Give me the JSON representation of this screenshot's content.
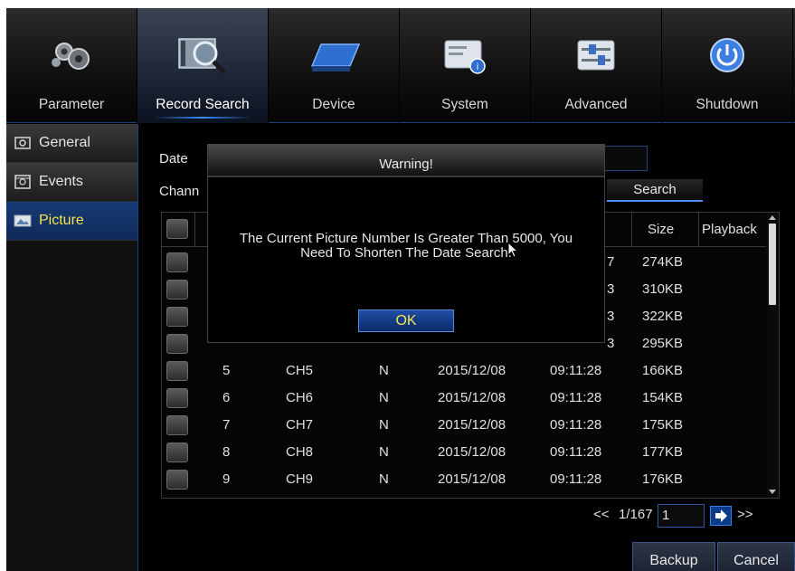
{
  "nav": {
    "items": [
      {
        "label": "Parameter",
        "icon": "gears-icon"
      },
      {
        "label": "Record Search",
        "icon": "film-search-icon"
      },
      {
        "label": "Device",
        "icon": "hard-drive-icon"
      },
      {
        "label": "System",
        "icon": "system-info-icon"
      },
      {
        "label": "Advanced",
        "icon": "sliders-icon"
      },
      {
        "label": "Shutdown",
        "icon": "power-icon"
      }
    ],
    "active": "Record Search"
  },
  "sidebar": {
    "items": [
      {
        "label": "General",
        "icon": "general-icon"
      },
      {
        "label": "Events",
        "icon": "events-icon"
      },
      {
        "label": "Picture",
        "icon": "picture-icon"
      }
    ],
    "active": "Picture"
  },
  "search": {
    "date_label": "Date",
    "channel_label": "Chann",
    "search_button": "Search"
  },
  "table": {
    "columns": {
      "size": "Size",
      "playback": "Playback"
    },
    "partial_rows": [
      {
        "time_tail": "7",
        "size": "274KB"
      },
      {
        "time_tail": "3",
        "size": "310KB"
      },
      {
        "time_tail": "3",
        "size": "322KB"
      },
      {
        "time_tail": "3",
        "size": "295KB"
      }
    ],
    "rows": [
      {
        "no": "5",
        "channel": "CH5",
        "type": "N",
        "date": "2015/12/08",
        "time": "09:11:28",
        "size": "166KB"
      },
      {
        "no": "6",
        "channel": "CH6",
        "type": "N",
        "date": "2015/12/08",
        "time": "09:11:28",
        "size": "154KB"
      },
      {
        "no": "7",
        "channel": "CH7",
        "type": "N",
        "date": "2015/12/08",
        "time": "09:11:28",
        "size": "175KB"
      },
      {
        "no": "8",
        "channel": "CH8",
        "type": "N",
        "date": "2015/12/08",
        "time": "09:11:28",
        "size": "177KB"
      },
      {
        "no": "9",
        "channel": "CH9",
        "type": "N",
        "date": "2015/12/08",
        "time": "09:11:28",
        "size": "176KB"
      }
    ]
  },
  "pager": {
    "prev": "<<",
    "page_info": "1/167",
    "page_input": "1",
    "next": ">>"
  },
  "buttons": {
    "backup": "Backup",
    "cancel": "Cancel"
  },
  "dialog": {
    "title": "Warning!",
    "line1": "The Current Picture Number Is Greater Than 5000, You",
    "line2": "Need To Shorten The Date Search.",
    "ok": "OK"
  },
  "colors": {
    "accent_blue": "#1b3f7a",
    "active_text": "#f3e64a",
    "ok_button": "#1f4da6"
  }
}
